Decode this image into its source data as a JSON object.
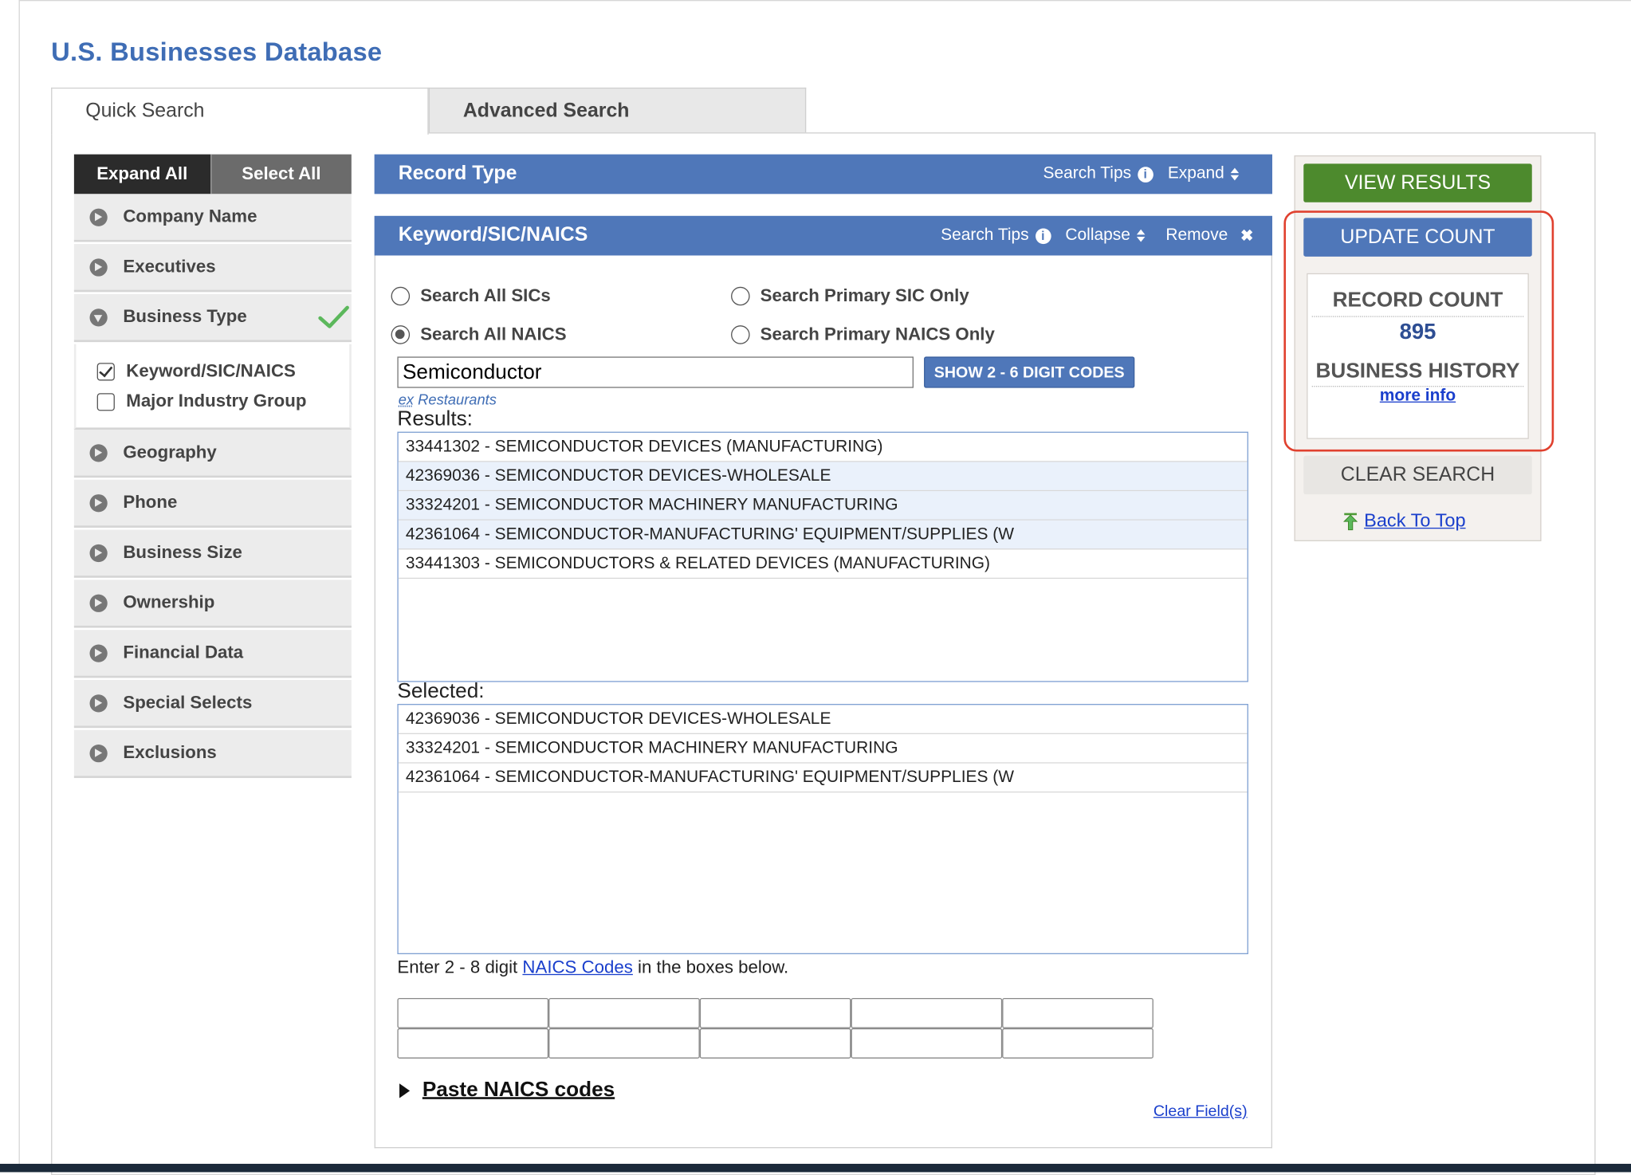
{
  "page": {
    "title": "U.S. Businesses Database"
  },
  "tabs": [
    {
      "label": "Quick Search",
      "active": true
    },
    {
      "label": "Advanced Search",
      "active": false
    }
  ],
  "sidebar": {
    "expand_all": "Expand All",
    "select_all": "Select All",
    "items": [
      {
        "label": "Company Name"
      },
      {
        "label": "Executives"
      },
      {
        "label": "Business Type",
        "expanded": true,
        "completed": true
      },
      {
        "label": "Geography"
      },
      {
        "label": "Phone"
      },
      {
        "label": "Business Size"
      },
      {
        "label": "Ownership"
      },
      {
        "label": "Financial Data"
      },
      {
        "label": "Special Selects"
      },
      {
        "label": "Exclusions"
      }
    ],
    "business_type_options": [
      {
        "label": "Keyword/SIC/NAICS",
        "checked": true
      },
      {
        "label": "Major Industry Group",
        "checked": false
      }
    ]
  },
  "record_type": {
    "title": "Record Type",
    "search_tips": "Search Tips",
    "info_icon": "i",
    "expand": "Expand"
  },
  "keyword": {
    "title": "Keyword/SIC/NAICS",
    "search_tips": "Search Tips",
    "info_icon": "i",
    "collapse": "Collapse",
    "remove": "Remove",
    "remove_icon": "✖",
    "radios": [
      {
        "label": "Search All SICs",
        "selected": false
      },
      {
        "label": "Search Primary SIC Only",
        "selected": false
      },
      {
        "label": "Search All NAICS",
        "selected": true
      },
      {
        "label": "Search Primary NAICS Only",
        "selected": false
      }
    ],
    "input_value": "Semiconductor",
    "show_codes_button": "SHOW 2 - 6 DIGIT CODES",
    "hint_prefix": "ex",
    "hint_text": " Restaurants",
    "results_label": "Results:",
    "results": [
      {
        "text": "33441302 - SEMICONDUCTOR DEVICES (MANUFACTURING)",
        "highlighted": false
      },
      {
        "text": "42369036 - SEMICONDUCTOR DEVICES-WHOLESALE",
        "highlighted": true
      },
      {
        "text": "33324201 - SEMICONDUCTOR MACHINERY MANUFACTURING",
        "highlighted": true
      },
      {
        "text": "42361064 - SEMICONDUCTOR-MANUFACTURING' EQUIPMENT/SUPPLIES (W",
        "highlighted": true
      },
      {
        "text": "33441303 - SEMICONDUCTORS & RELATED DEVICES (MANUFACTURING)",
        "highlighted": false
      }
    ],
    "selected_label": "Selected:",
    "selected": [
      "42369036 - SEMICONDUCTOR DEVICES-WHOLESALE",
      "33324201 - SEMICONDUCTOR MACHINERY MANUFACTURING",
      "42361064 - SEMICONDUCTOR-MANUFACTURING' EQUIPMENT/SUPPLIES (W"
    ],
    "naics_note_before": "Enter 2 - 8 digit ",
    "naics_link": "NAICS Codes",
    "naics_note_after": " in the boxes below.",
    "code_boxes": [
      "",
      "",
      "",
      "",
      "",
      "",
      "",
      "",
      "",
      ""
    ],
    "paste_label": "Paste NAICS codes",
    "clear_fields": "Clear Field(s)"
  },
  "actions": {
    "view_results": "VIEW RESULTS",
    "update_count": "UPDATE COUNT",
    "record_count_label": "RECORD COUNT",
    "record_count_value": "895",
    "business_history_label": "BUSINESS HISTORY",
    "more_info": "more info",
    "clear_search": "CLEAR SEARCH",
    "back_to_top": "Back To Top"
  },
  "colors": {
    "accent_blue": "#4f77b9",
    "title_blue": "#3f6db5",
    "green_button": "#4d8a2d",
    "highlight_outline": "#e0412f",
    "check_green": "#5cb85c"
  },
  "icons": {
    "sidebar_item": "circle-arrow-right-icon",
    "sidebar_item_expanded": "circle-arrow-down-icon",
    "completed": "green-checkmark-icon",
    "info": "info-circle-icon",
    "sort": "sort-arrows-icon",
    "remove": "close-x-icon",
    "back_to_top": "green-up-arrow-icon",
    "paste_toggle": "triangle-right-icon"
  }
}
